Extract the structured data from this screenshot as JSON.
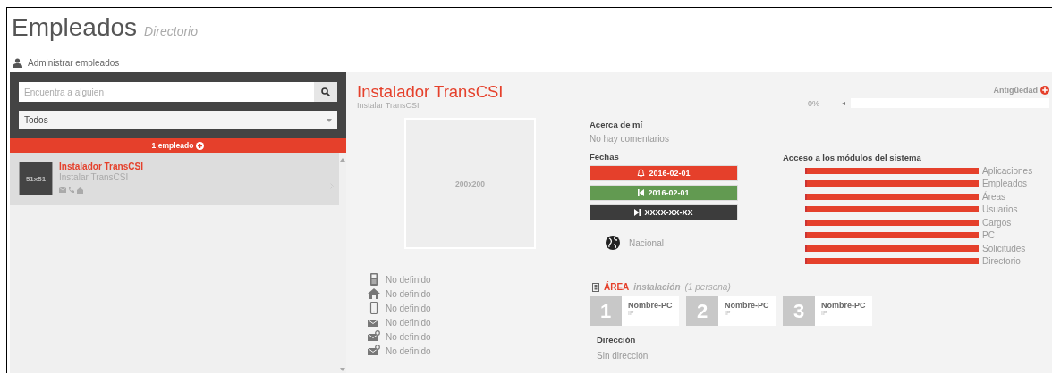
{
  "header": {
    "title": "Empleados",
    "subtitle": "Directorio",
    "breadcrumb": "Administrar empleados"
  },
  "sidebar": {
    "search": {
      "placeholder": "Encuentra a alguien"
    },
    "filter": {
      "value": "Todos"
    },
    "count": "1 empleado",
    "employees": [
      {
        "avatar": "51x51",
        "name": "Instalador TransCSI",
        "role": "Instalar TransCSI",
        "selected": true
      }
    ]
  },
  "profile": {
    "name": "Instalador TransCSI",
    "role": "Instalar TransCSI",
    "photo": "200x200",
    "seniority": {
      "label": "Antigüedad",
      "reading": "0%",
      "level": 0
    },
    "about_title": "Acerca de mí",
    "about": "No hay comentarios",
    "dates_title": "Fechas",
    "dates": [
      {
        "kind": "alert",
        "label": "2016-02-01"
      },
      {
        "kind": "start",
        "label": "2016-02-01"
      },
      {
        "kind": "end",
        "label": "XXXX-XX-XX"
      }
    ],
    "nationality": "Nacional",
    "modules_title": "Acceso a los módulos del sistema",
    "modules": [
      {
        "name": "Aplicaciones"
      },
      {
        "name": "Empleados"
      },
      {
        "name": "Áreas"
      },
      {
        "name": "Usuarios"
      },
      {
        "name": "Cargos"
      },
      {
        "name": "PC"
      },
      {
        "name": "Solicitudes"
      },
      {
        "name": "Directorio"
      }
    ],
    "contacts": [
      {
        "kind": "office-phone",
        "value": "No definido"
      },
      {
        "kind": "home",
        "value": "No definido"
      },
      {
        "kind": "mobile",
        "value": "No definido"
      },
      {
        "kind": "mail",
        "value": "No definido"
      },
      {
        "kind": "mail-alt",
        "value": "No definido"
      },
      {
        "kind": "mail-alt",
        "value": "No definido"
      }
    ],
    "area": {
      "label": "ÁREA",
      "name": "instalación",
      "count": "(1 persona)"
    },
    "pcs": [
      {
        "number": "1",
        "name": "Nombre-PC",
        "ip": "IP"
      },
      {
        "number": "2",
        "name": "Nombre-PC",
        "ip": "IP"
      },
      {
        "number": "3",
        "name": "Nombre-PC",
        "ip": "IP"
      }
    ],
    "address_title": "Dirección",
    "address": "Sin dirección"
  }
}
